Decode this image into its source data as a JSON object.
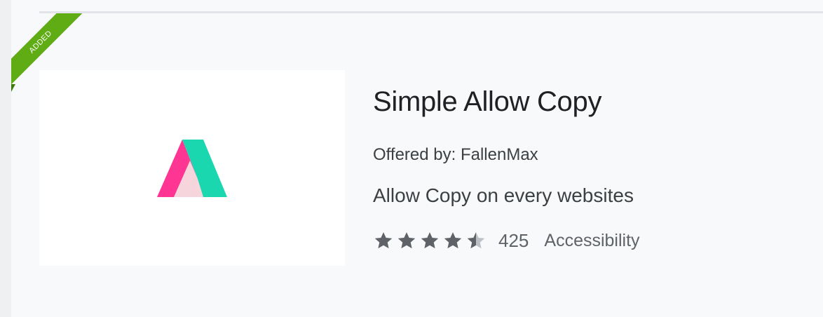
{
  "badge": {
    "label": "ADDED",
    "color": "#5fac14"
  },
  "extension": {
    "name": "Simple Allow Copy",
    "offered_by": "Offered by: FallenMax",
    "description": "Allow Copy on every websites",
    "rating": {
      "value": 4.5,
      "max": 5,
      "count": "425"
    },
    "category": "Accessibility",
    "logo_icon": "mountain-logo-icon",
    "logo_colors": {
      "pink": "#fe3593",
      "teal": "#1ad7b0",
      "overlap": "#f7d5dc"
    }
  },
  "colors": {
    "star": "#5f6368",
    "star_empty": "#bdc1c6"
  }
}
